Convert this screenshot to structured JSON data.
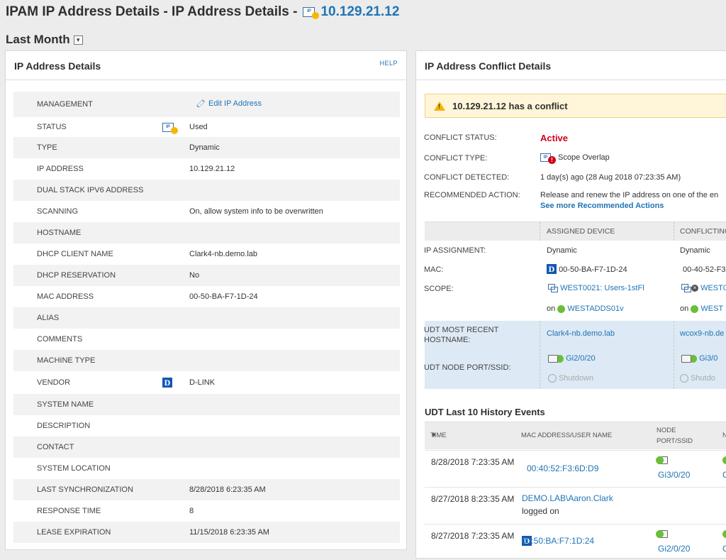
{
  "page": {
    "title_prefix": "IPAM IP Address Details - IP Address Details -",
    "ip": "10.129.21.12",
    "timeframe": "Last Month"
  },
  "left_panel": {
    "title": "IP Address Details",
    "help": "HELP",
    "rows": [
      {
        "label": "MANAGEMENT",
        "value": "Edit IP Address",
        "icon": "edit-icon",
        "link": true
      },
      {
        "label": "STATUS",
        "value": "Used",
        "icon": "ip-used-icon"
      },
      {
        "label": "TYPE",
        "value": "Dynamic"
      },
      {
        "label": "IP ADDRESS",
        "value": "10.129.21.12"
      },
      {
        "label": "DUAL STACK IPV6 ADDRESS",
        "value": ""
      },
      {
        "label": "SCANNING",
        "value": "On, allow system info to be overwritten"
      },
      {
        "label": "HOSTNAME",
        "value": ""
      },
      {
        "label": "DHCP CLIENT NAME",
        "value": "Clark4-nb.demo.lab"
      },
      {
        "label": "DHCP RESERVATION",
        "value": "No"
      },
      {
        "label": "MAC ADDRESS",
        "value": "00-50-BA-F7-1D-24"
      },
      {
        "label": "ALIAS",
        "value": ""
      },
      {
        "label": "COMMENTS",
        "value": ""
      },
      {
        "label": "MACHINE TYPE",
        "value": ""
      },
      {
        "label": "VENDOR",
        "value": "D-LINK",
        "icon": "dlink-icon"
      },
      {
        "label": "SYSTEM NAME",
        "value": ""
      },
      {
        "label": "DESCRIPTION",
        "value": ""
      },
      {
        "label": "CONTACT",
        "value": ""
      },
      {
        "label": "SYSTEM LOCATION",
        "value": ""
      },
      {
        "label": "LAST SYNCHRONIZATION",
        "value": "8/28/2018 6:23:35 AM"
      },
      {
        "label": "RESPONSE TIME",
        "value": "8"
      },
      {
        "label": "LEASE EXPIRATION",
        "value": "11/15/2018 6:23:35 AM"
      }
    ]
  },
  "right_panel": {
    "title": "IP Address Conflict Details",
    "banner": "10.129.21.12 has a conflict",
    "status_label": "CONFLICT STATUS:",
    "status_value": "Active",
    "type_label": "CONFLICT TYPE:",
    "type_value": "Scope Overlap",
    "detected_label": "CONFLICT DETECTED:",
    "detected_value": "1 day(s) ago (28 Aug 2018 07:23:35 AM)",
    "action_label": "RECOMMENDED ACTION:",
    "action_value": "Release and renew the IP address on one of the en",
    "action_link": "See more Recommended Actions",
    "table": {
      "col_assigned": "ASSIGNED DEVICE",
      "col_conflicting": "CONFLICTING",
      "ip_assignment_label": "IP ASSIGNMENT:",
      "ip_assigned": "Dynamic",
      "ip_conflicting": "Dynamic",
      "mac_label": "MAC:",
      "mac_assigned": "00-50-BA-F7-1D-24",
      "mac_conflicting": "00-40-52-F3",
      "scope_label": "SCOPE:",
      "scope_assigned": "WEST0021: Users-1stFl",
      "scope_conflicting": "WEST0",
      "on": "on",
      "server_assigned": "WESTADDS01v",
      "server_conflicting": "WEST",
      "udt_host_label": "UDT MOST RECENT HOSTNAME:",
      "udt_host_assigned": "Clark4-nb.demo.lab",
      "udt_host_conflicting": "wcox9-nb.de",
      "udt_port_label": "UDT NODE PORT/SSID:",
      "udt_port_assigned": "Gi2/0/20",
      "udt_port_conflicting": "Gi3/0",
      "shutdown_assigned": "Shutdown",
      "shutdown_conflicting": "Shutdo"
    },
    "history": {
      "title": "UDT Last 10 History Events",
      "col_time": "TIME",
      "col_mac": "MAC ADDRESS/USER NAME",
      "col_port_1": "NODE",
      "col_port_2": "PORT/SSID",
      "col_n": "N",
      "rows": [
        {
          "time": "8/28/2018 7:23:35 AM",
          "mac": "00:40:52:F3:6D:D9",
          "port": "Gi3/0/20",
          "extra": "C"
        },
        {
          "time": "8/27/2018 8:23:35 AM",
          "mac": "DEMO.LAB\\Aaron.Clark",
          "sub": "logged on",
          "port": ""
        },
        {
          "time": "8/27/2018 7:23:35 AM",
          "mac": "00:50:BA:F7:1D:24",
          "port": "Gi2/0/20",
          "extra": "C"
        }
      ]
    }
  },
  "colors": {
    "link": "#1f74b5",
    "active": "#d0021b",
    "accent_yellow": "#f5b800",
    "status_green": "#6abf3a"
  }
}
